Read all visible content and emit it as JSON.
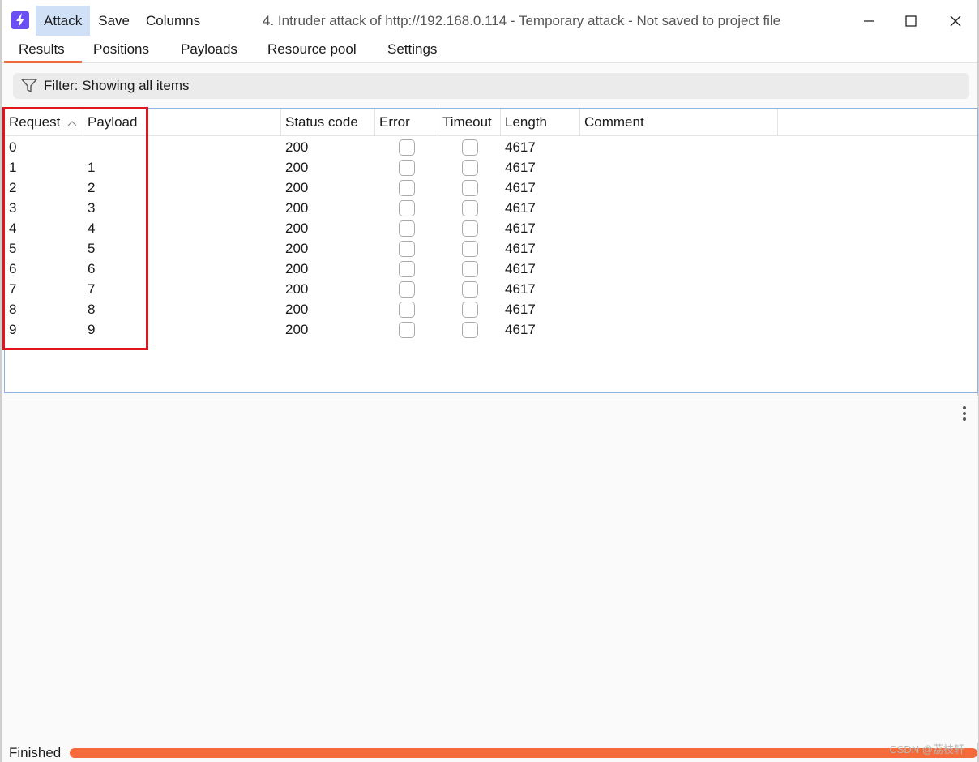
{
  "menu": {
    "items": [
      "Attack",
      "Save",
      "Columns"
    ]
  },
  "window": {
    "title": "4. Intruder attack of http://192.168.0.114 - Temporary attack - Not saved to project file"
  },
  "tabs": [
    "Results",
    "Positions",
    "Payloads",
    "Resource pool",
    "Settings"
  ],
  "filter": {
    "label": "Filter: Showing all items"
  },
  "table": {
    "columns": [
      "Request",
      "Payload",
      "Status code",
      "Error",
      "Timeout",
      "Length",
      "Comment"
    ],
    "sort_column": "Request",
    "rows": [
      {
        "request": "0",
        "payload": "",
        "status": "200",
        "length": "4617"
      },
      {
        "request": "1",
        "payload": "1",
        "status": "200",
        "length": "4617"
      },
      {
        "request": "2",
        "payload": "2",
        "status": "200",
        "length": "4617"
      },
      {
        "request": "3",
        "payload": "3",
        "status": "200",
        "length": "4617"
      },
      {
        "request": "4",
        "payload": "4",
        "status": "200",
        "length": "4617"
      },
      {
        "request": "5",
        "payload": "5",
        "status": "200",
        "length": "4617"
      },
      {
        "request": "6",
        "payload": "6",
        "status": "200",
        "length": "4617"
      },
      {
        "request": "7",
        "payload": "7",
        "status": "200",
        "length": "4617"
      },
      {
        "request": "8",
        "payload": "8",
        "status": "200",
        "length": "4617"
      },
      {
        "request": "9",
        "payload": "9",
        "status": "200",
        "length": "4617"
      }
    ]
  },
  "status": {
    "text": "Finished",
    "progress_percent": 100,
    "watermark": "CSDN @荔枝轩"
  },
  "colors": {
    "accent": "#f06a3c",
    "highlight": "#e3141b",
    "app_icon": "#6a4ff5"
  }
}
